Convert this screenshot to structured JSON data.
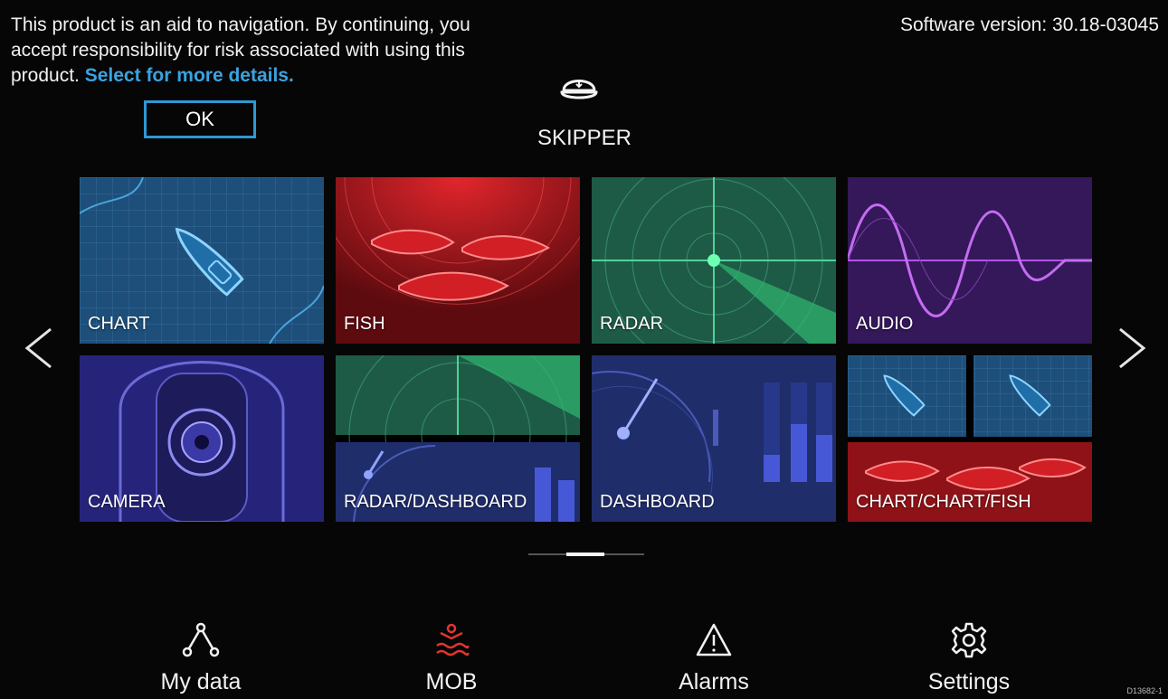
{
  "disclaimer": {
    "text": "This product is an aid to navigation. By continuing, you accept responsibility for risk associated with using this product.",
    "link": "Select for more details.",
    "ok_label": "OK"
  },
  "software_version": "Software version: 30.18-03045",
  "profile": {
    "icon": "captain-hat-icon",
    "name": "SKIPPER"
  },
  "apps": [
    {
      "label": "CHART",
      "theme": "#1d4f7a"
    },
    {
      "label": "FISH",
      "theme": "#a3141a"
    },
    {
      "label": "RADAR",
      "theme": "#1e5b47"
    },
    {
      "label": "AUDIO",
      "theme": "#3c1a5e"
    },
    {
      "label": "CAMERA",
      "theme": "#2a2a7a"
    },
    {
      "label": "RADAR/DASHBOARD",
      "theme": "#1f2d6b"
    },
    {
      "label": "DASHBOARD",
      "theme": "#1f2d6b"
    },
    {
      "label": "CHART/CHART/FISH",
      "theme": "#1d4f7a"
    }
  ],
  "pager": {
    "pages": 3,
    "current": 2
  },
  "bottom_nav": [
    {
      "label": "My data",
      "icon": "my-data-icon"
    },
    {
      "label": "MOB",
      "icon": "mob-icon",
      "color": "#e0362c"
    },
    {
      "label": "Alarms",
      "icon": "alarm-warning-icon"
    },
    {
      "label": "Settings",
      "icon": "gear-icon"
    }
  ],
  "doc_id": "D13682-1"
}
